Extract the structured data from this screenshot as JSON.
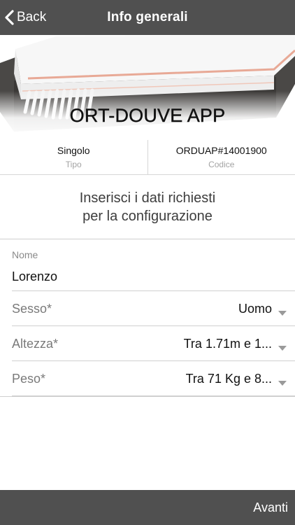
{
  "header": {
    "back_label": "Back",
    "title": "Info generali"
  },
  "product": {
    "name": "ORT-DOUVE APP",
    "type_value": "Singolo",
    "type_label": "Tipo",
    "code_value": "ORDUAP#14001900",
    "code_label": "Codice"
  },
  "instruction": {
    "line1": "Inserisci i dati richiesti",
    "line2": "per la configurazione"
  },
  "form": {
    "name_label": "Nome",
    "name_value": "Lorenzo",
    "sex_label": "Sesso*",
    "sex_value": "Uomo",
    "height_label": "Altezza*",
    "height_value": "Tra 1.71m e 1...",
    "weight_label": "Peso*",
    "weight_value": "Tra 71 Kg e 8..."
  },
  "footer": {
    "next_label": "Avanti"
  },
  "colors": {
    "bar": "#505050",
    "divider": "#d0d0d0",
    "accent_stitch": "#e8a996"
  }
}
